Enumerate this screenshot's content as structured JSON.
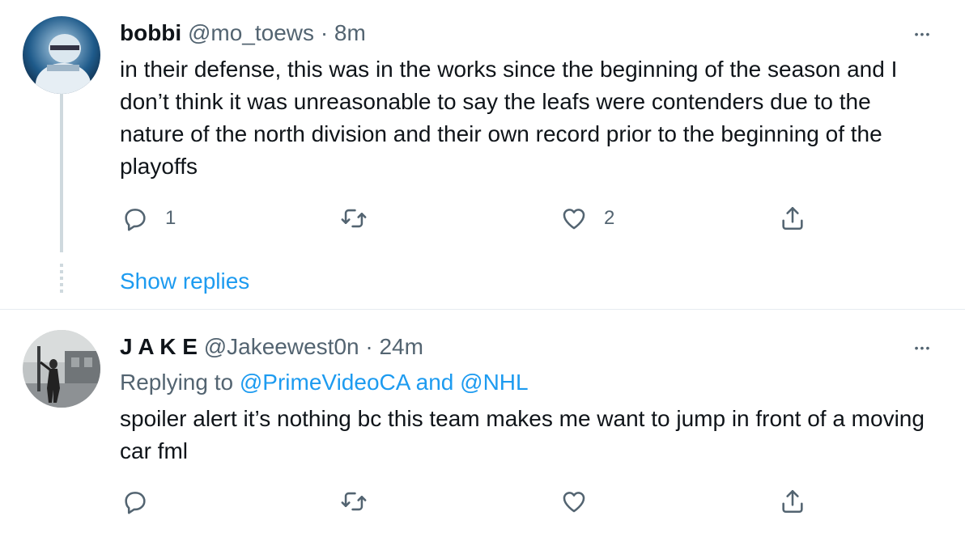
{
  "tweets": [
    {
      "display_name": "bobbi",
      "handle": "@mo_toews",
      "separator": "·",
      "time": "8m",
      "more_label": "•••",
      "text": "in their defense, this was in the works since the beginning of the season and I don’t think it was unreasonable to say the leafs were contenders due to the nature of the north division and their own record prior to the beginning of the playoffs",
      "reply_count": "1",
      "retweet_count": "",
      "like_count": "2",
      "show_replies": "Show replies"
    },
    {
      "display_name": "J A K E",
      "handle": "@Jakeewest0n",
      "separator": "·",
      "time": "24m",
      "more_label": "•••",
      "replying_prefix": "Replying to",
      "replying_user1": "@PrimeVideoCA",
      "replying_and": "and",
      "replying_user2": "@NHL",
      "text": "spoiler alert it’s nothing bc this team makes me want to jump in front of a moving car fml",
      "reply_count": "",
      "retweet_count": "",
      "like_count": ""
    }
  ],
  "colors": {
    "link": "#1d9bf0",
    "secondary_text": "#536471",
    "primary_text": "#0f1419",
    "thread_line": "#cfd9de"
  },
  "icons": [
    "reply-icon",
    "retweet-icon",
    "like-icon",
    "share-icon",
    "more-icon"
  ]
}
